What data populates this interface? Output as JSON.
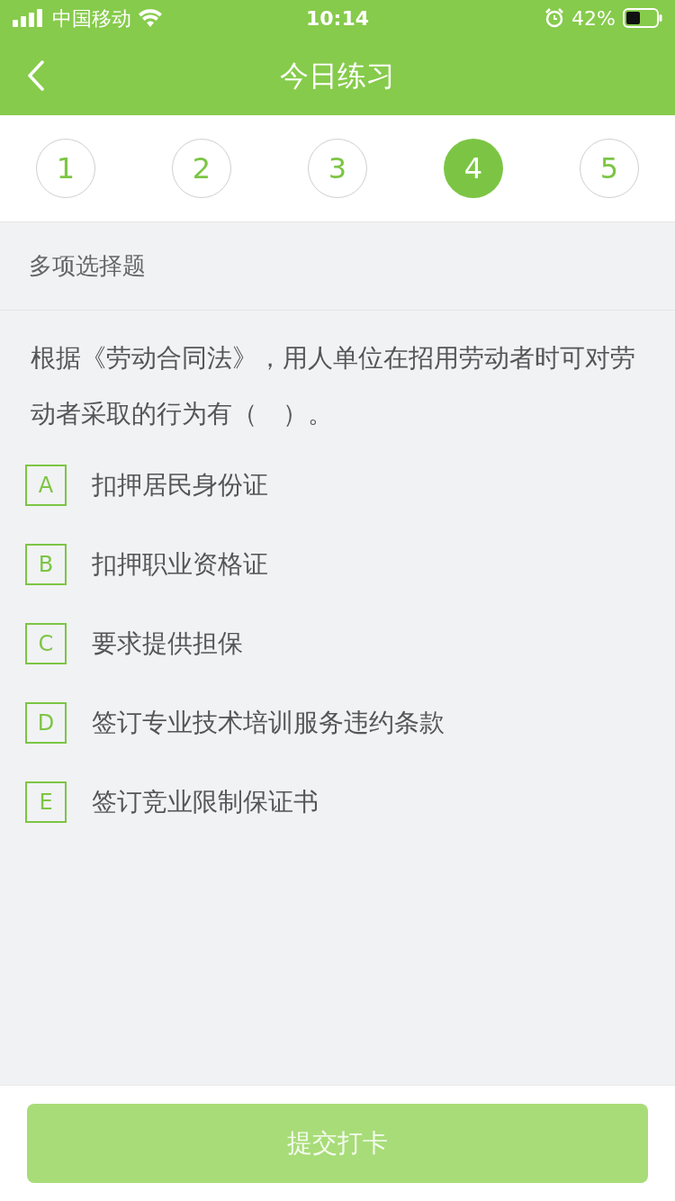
{
  "status_bar": {
    "carrier": "中国移动",
    "time": "10:14",
    "battery": "42%"
  },
  "nav": {
    "title": "今日练习"
  },
  "questions": [
    {
      "label": "1",
      "selected": false
    },
    {
      "label": "2",
      "selected": false
    },
    {
      "label": "3",
      "selected": false
    },
    {
      "label": "4",
      "selected": true
    },
    {
      "label": "5",
      "selected": false
    }
  ],
  "section": {
    "title": "多项选择题"
  },
  "question": {
    "text": "根据《劳动合同法》，用人单位在招用劳动者时可对劳动者采取的行为有（　）。"
  },
  "options": [
    {
      "letter": "A",
      "text": "扣押居民身份证",
      "checked": false
    },
    {
      "letter": "B",
      "text": "扣押职业资格证",
      "checked": false
    },
    {
      "letter": "C",
      "text": "要求提供担保",
      "checked": false
    },
    {
      "letter": "D",
      "text": "签订专业技术培训服务违约条款",
      "checked": false
    },
    {
      "letter": "E",
      "text": "签订竞业限制保证书",
      "checked": false
    }
  ],
  "submit": {
    "label": "提交打卡",
    "disabled": true
  }
}
